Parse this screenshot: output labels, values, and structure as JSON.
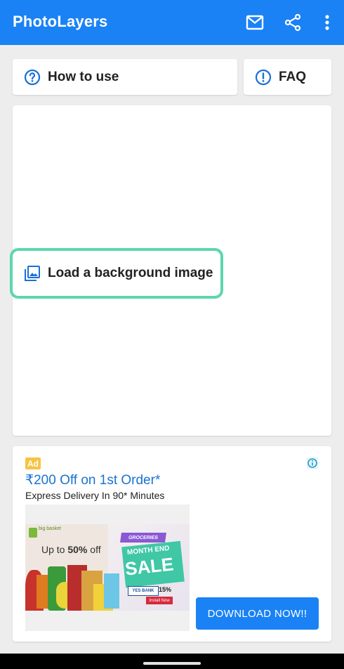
{
  "app": {
    "title": "PhotoLayers"
  },
  "toolbar": {
    "mail_icon": "mail-icon",
    "share_icon": "share-icon",
    "more_icon": "more-vert-icon"
  },
  "buttons": {
    "how_to_use": "How to use",
    "faq": "FAQ",
    "load_background": "Load a background image"
  },
  "ad": {
    "badge": "Ad",
    "title": "₹200 Off on 1st Order*",
    "subtitle": "Express Delivery In 90* Minutes",
    "banner": {
      "brand": "big basket",
      "offer_prefix": "Up to ",
      "offer_value": "50%",
      "offer_suffix": " off",
      "tag": "GROCERIES",
      "headline": "MONTH END",
      "sale": "SALE",
      "bank": "YES BANK",
      "discount": "15%",
      "cta": "Install Now"
    },
    "download_label": "DOWNLOAD NOW!!"
  },
  "colors": {
    "primary": "#1a82f5",
    "accent_outline": "#5dd6b0",
    "ad_link": "#1a73d1",
    "ad_badge": "#f6c443"
  }
}
